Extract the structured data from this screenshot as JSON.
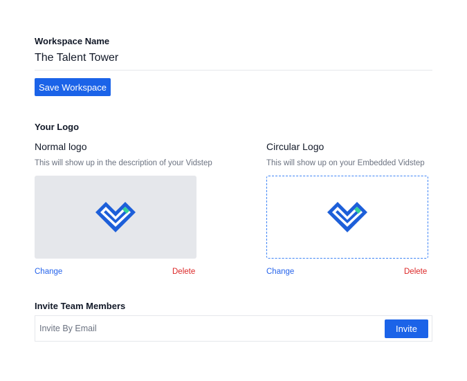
{
  "workspace": {
    "label": "Workspace Name",
    "value": "The Talent Tower",
    "save_label": "Save Workspace"
  },
  "logo": {
    "section_label": "Your Logo",
    "normal": {
      "title": "Normal logo",
      "description": "This will show up in the description of your Vidstep",
      "change_label": "Change",
      "delete_label": "Delete",
      "icon": "vidstep-heart-logo-icon"
    },
    "circular": {
      "title": "Circular Logo",
      "description": "This will show up on your Embedded Vidstep",
      "change_label": "Change",
      "delete_label": "Delete",
      "icon": "vidstep-heart-logo-icon"
    }
  },
  "invite": {
    "label": "Invite Team Members",
    "placeholder": "Invite By Email",
    "button_label": "Invite"
  },
  "colors": {
    "primary": "#1b63e8",
    "logo_blue": "#1d5fd9",
    "logo_accent": "#34d399",
    "delete_red": "#dc2626",
    "muted_text": "#6b7280",
    "box_gray": "#e5e7eb",
    "dashed_border": "#3b82f6"
  }
}
